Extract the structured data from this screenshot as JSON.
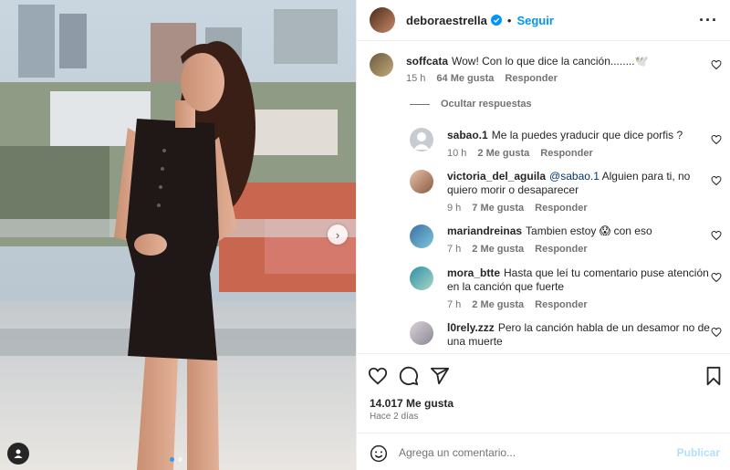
{
  "post": {
    "username": "deboraestrella",
    "separator": "•",
    "follow_label": "Seguir",
    "more_label": "···"
  },
  "media": {
    "next_label": "›"
  },
  "comments": [
    {
      "username": "soffcata",
      "text": "Wow! Con lo que dice la canción........🕊️",
      "time": "15 h",
      "likes": "64 Me gusta",
      "reply": "Responder"
    }
  ],
  "hide_replies_label": "Ocultar respuestas",
  "replies": [
    {
      "username": "sabao.1",
      "mention": "",
      "text": "Me la puedes yraducir que dice porfis ?",
      "time": "10 h",
      "likes": "2 Me gusta",
      "reply": "Responder"
    },
    {
      "username": "victoria_del_aguila",
      "mention": "@sabao.1",
      "text": "Alguien para ti, no quiero morir o desaparecer",
      "time": "9 h",
      "likes": "7 Me gusta",
      "reply": "Responder"
    },
    {
      "username": "mariandreinas",
      "mention": "",
      "text": "Tambien estoy 😱 con eso",
      "time": "7 h",
      "likes": "2 Me gusta",
      "reply": "Responder"
    },
    {
      "username": "mora_btte",
      "mention": "",
      "text": "Hasta que leí tu comentario puse atención en la canción que fuerte",
      "time": "7 h",
      "likes": "2 Me gusta",
      "reply": "Responder"
    },
    {
      "username": "l0rely.zzz",
      "mention": "",
      "text": "Pero la canción habla de un desamor no de una muerte",
      "time": "",
      "likes": "",
      "reply": ""
    }
  ],
  "likes_count": "14.017 Me gusta",
  "date": "Hace 2 días",
  "add_comment": {
    "placeholder": "Agrega un comentario...",
    "publish_label": "Publicar"
  },
  "colors": {
    "accent": "#0095f6",
    "publish_disabled": "#b2dffc",
    "text": "#262626",
    "muted": "#737373"
  }
}
